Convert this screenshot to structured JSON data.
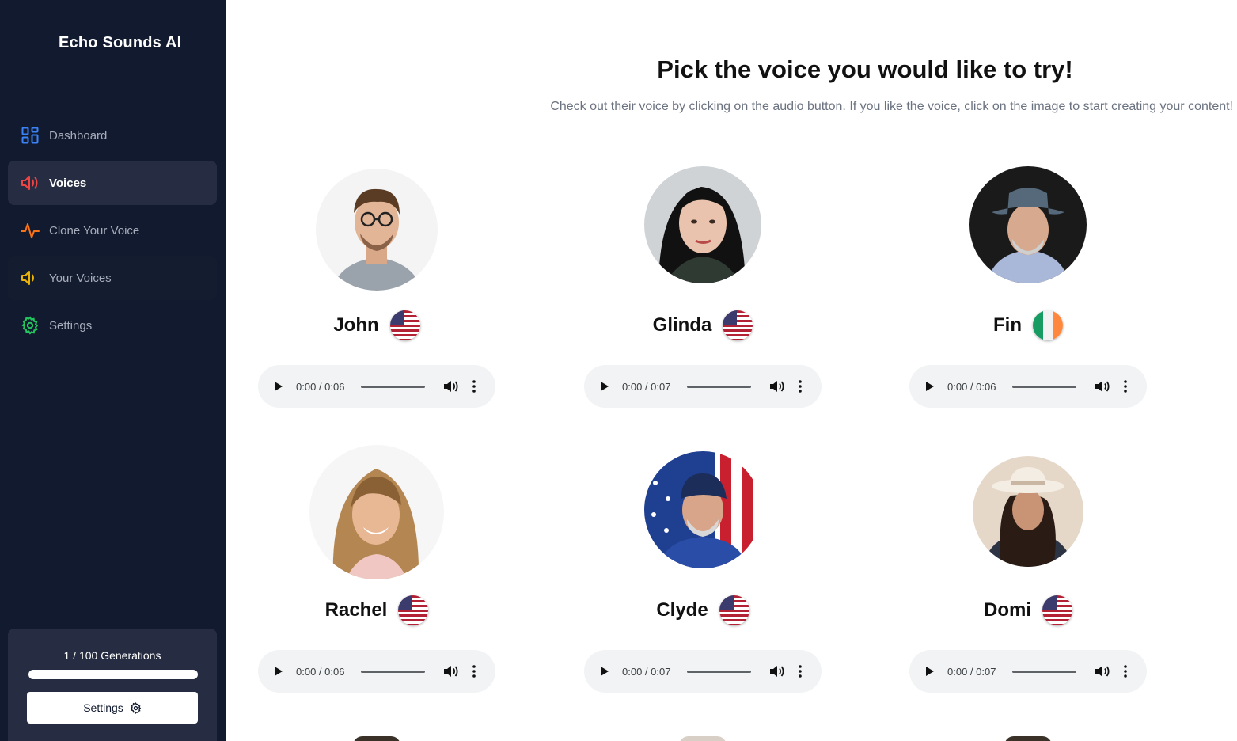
{
  "brand": {
    "name": "Echo Sounds AI",
    "icon": "waveform-logo-icon"
  },
  "nav": {
    "items": [
      {
        "label": "Dashboard",
        "icon": "grid-icon",
        "color": "#3b82f6"
      },
      {
        "label": "Voices",
        "icon": "speaker-wave-icon",
        "color": "#ef4444"
      },
      {
        "label": "Clone Your Voice",
        "icon": "pulse-icon",
        "color": "#f97316"
      },
      {
        "label": "Your Voices",
        "icon": "speaker-icon",
        "color": "#eab308"
      },
      {
        "label": "Settings",
        "icon": "gear-icon",
        "color": "#22c55e"
      }
    ]
  },
  "generations": {
    "label": "1 / 100 Generations",
    "used": 1,
    "total": 100
  },
  "settings_button": {
    "label": "Settings",
    "icon": "gear-icon"
  },
  "header": {
    "title": "Pick the voice you would like to try!",
    "subtitle": "Check out their voice by clicking on the audio button. If you like the voice, click on the image to start creating your content!"
  },
  "voices": [
    {
      "name": "John",
      "flag": "us-flag-icon",
      "time": "0:00 / 0:06"
    },
    {
      "name": "Glinda",
      "flag": "us-flag-icon",
      "time": "0:00 / 0:07"
    },
    {
      "name": "Fin",
      "flag": "ireland-flag-icon",
      "time": "0:00 / 0:06"
    },
    {
      "name": "Rachel",
      "flag": "us-flag-icon",
      "time": "0:00 / 0:06"
    },
    {
      "name": "Clyde",
      "flag": "us-flag-icon",
      "time": "0:00 / 0:07"
    },
    {
      "name": "Domi",
      "flag": "us-flag-icon",
      "time": "0:00 / 0:07"
    }
  ],
  "colors": {
    "sidebar_bg": "#111a2e",
    "active_bg": "#262d42",
    "player_bg": "#f1f3f4"
  }
}
